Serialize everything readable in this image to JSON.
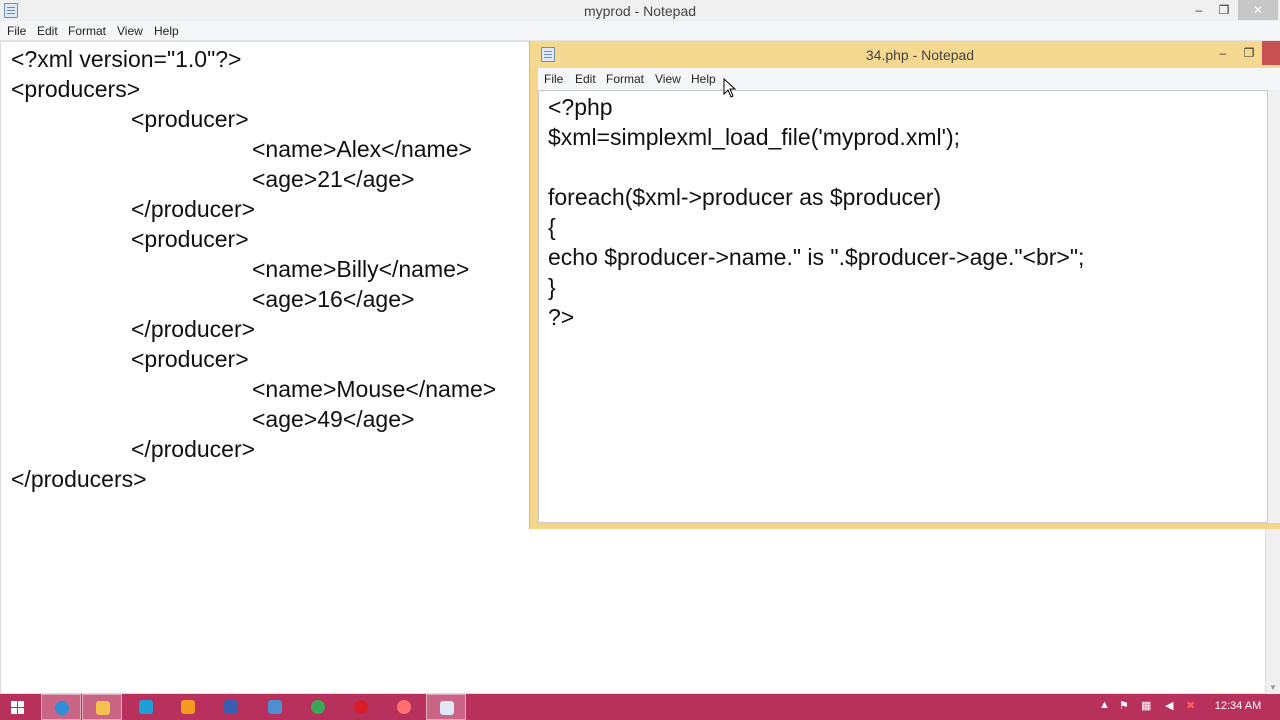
{
  "back_window": {
    "title": "myprod - Notepad",
    "menu": [
      "File",
      "Edit",
      "Format",
      "View",
      "Help"
    ],
    "lines": [
      "<?xml version=\"1.0\"?>",
      "<producers>",
      "<producer>",
      "<name>Alex</name>",
      "<age>21</age>",
      "</producer>",
      "<producer>",
      "<name>Billy</name>",
      "<age>16</age>",
      "</producer>",
      "<producer>",
      "<name>Mouse</name>",
      "<age>49</age>",
      "</producer>",
      "</producers>"
    ]
  },
  "front_window": {
    "title": "34.php - Notepad",
    "menu": [
      "File",
      "Edit",
      "Format",
      "View",
      "Help"
    ],
    "lines": [
      "<?php",
      "$xml=simplexml_load_file('myprod.xml');",
      "",
      "foreach($xml->producer as $producer)",
      "{",
      "echo $producer->name.\" is \".$producer->age.\"<br>\";",
      "}",
      "?>"
    ]
  },
  "window_controls": {
    "minimize": "–",
    "maximize": "❐",
    "close": "✕"
  },
  "taskbar": {
    "items": [
      {
        "icon": "internet-explorer-icon",
        "color": "#2f8fd8"
      },
      {
        "icon": "file-explorer-icon",
        "color": "#f2c14e"
      },
      {
        "icon": "store-icon",
        "color": "#1e9fd6"
      },
      {
        "icon": "search-app-icon",
        "color": "#f29b1d"
      },
      {
        "icon": "media-app-icon",
        "color": "#3a5fb0"
      },
      {
        "icon": "keyboard-app-icon",
        "color": "#4d8fd1"
      },
      {
        "icon": "chrome-icon",
        "color": "#3aa757"
      },
      {
        "icon": "recorder-icon",
        "color": "#d81e2a"
      },
      {
        "icon": "media-player-icon",
        "color": "#ff6f6f"
      },
      {
        "icon": "notepad-icon",
        "color": "#dfe9f5"
      }
    ],
    "clock": "12:34 AM"
  }
}
